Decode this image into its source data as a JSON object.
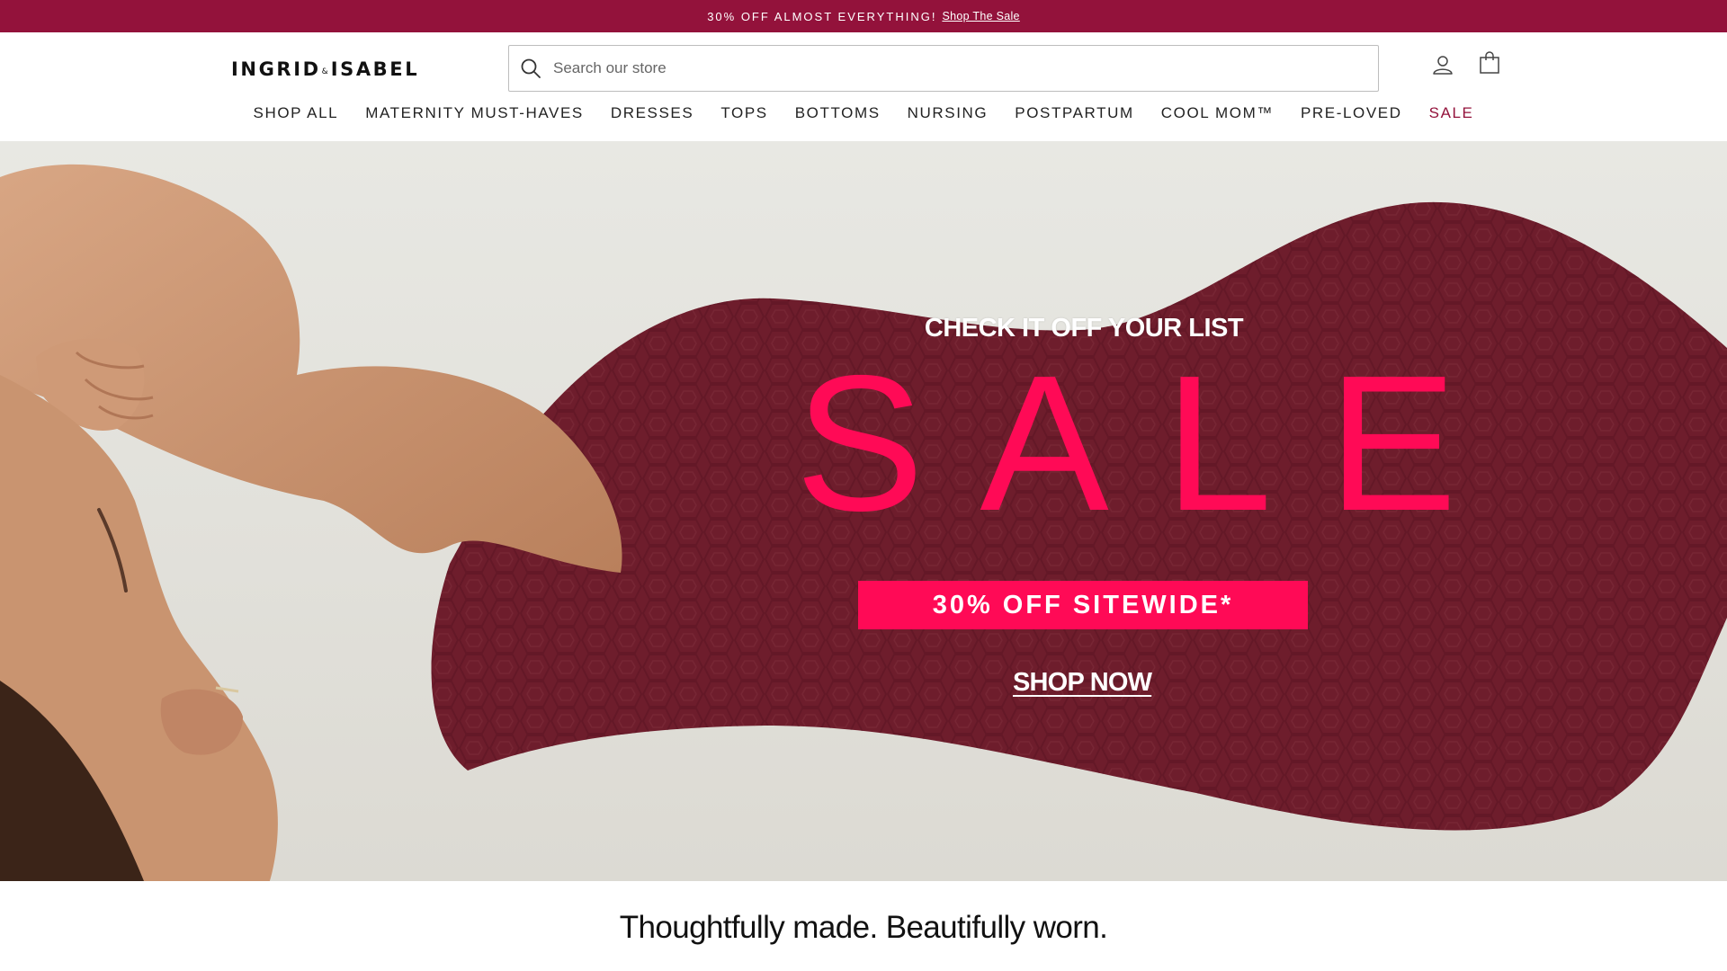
{
  "announcement": {
    "text": "30% OFF ALMOST EVERYTHING!",
    "link": "Shop The Sale"
  },
  "header": {
    "logo_left": "INGRID",
    "logo_amp": "&",
    "logo_right": "ISABEL",
    "search_placeholder": "Search our store"
  },
  "nav": {
    "items": [
      {
        "label": "SHOP ALL"
      },
      {
        "label": "MATERNITY MUST-HAVES"
      },
      {
        "label": "DRESSES"
      },
      {
        "label": "TOPS"
      },
      {
        "label": "BOTTOMS"
      },
      {
        "label": "NURSING"
      },
      {
        "label": "POSTPARTUM"
      },
      {
        "label": "COOL MOM™"
      },
      {
        "label": "PRE-LOVED"
      },
      {
        "label": "SALE"
      }
    ]
  },
  "hero": {
    "kicker": "CHECK IT OFF YOUR LIST",
    "headline": "SALE",
    "badge": "30% OFF SITEWIDE*",
    "cta": "SHOP NOW"
  },
  "tagline": "Thoughtfully made. Beautifully worn.",
  "colors": {
    "brand": "#93123b",
    "accent": "#ff0a56",
    "dress": "#6e1d2c",
    "skin": "#c99470"
  },
  "icons": {
    "search": "search-icon",
    "account": "account-icon",
    "cart": "cart-icon"
  }
}
